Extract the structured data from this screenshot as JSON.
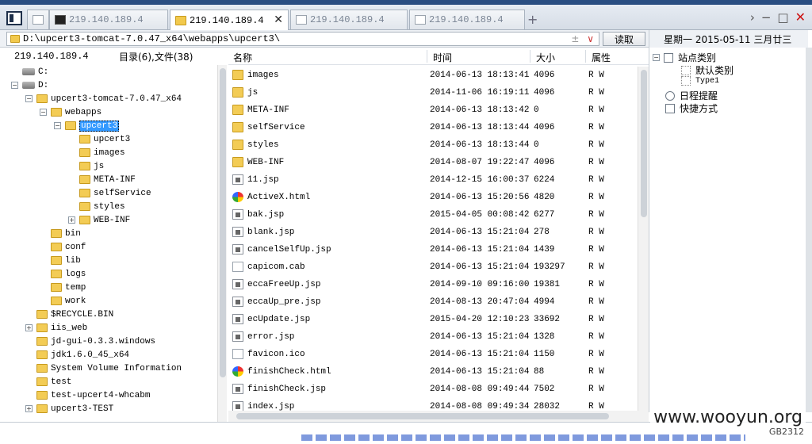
{
  "tabs": [
    {
      "label": "",
      "icon": "blank-page-icon",
      "active": false
    },
    {
      "label": "219.140.189.4",
      "icon": "terminal-icon",
      "active": false
    },
    {
      "label": "219.140.189.4",
      "icon": "folder-icon",
      "active": true
    },
    {
      "label": "219.140.189.4",
      "icon": "page-icon",
      "active": false
    },
    {
      "label": "219.140.189.4",
      "icon": "page-icon",
      "active": false
    }
  ],
  "address": {
    "path": "D:\\upcert3-tomcat-7.0.47_x64\\webapps\\upcert3\\",
    "read_label": "读取",
    "tools": "±"
  },
  "left_info": {
    "ip": "219.140.189.4",
    "counts": "目录(6),文件(38)"
  },
  "tree": [
    {
      "label": "C:",
      "type": "drive",
      "level": 0,
      "exp": ""
    },
    {
      "label": "D:",
      "type": "drive",
      "level": 0,
      "exp": "−"
    },
    {
      "label": "upcert3-tomcat-7.0.47_x64",
      "type": "folder",
      "level": 1,
      "exp": "−"
    },
    {
      "label": "webapps",
      "type": "folder",
      "level": 2,
      "exp": "−"
    },
    {
      "label": "upcert3",
      "type": "folder",
      "level": 3,
      "exp": "−",
      "selected": true
    },
    {
      "label": "upcert3",
      "type": "folder",
      "level": 4,
      "exp": ""
    },
    {
      "label": "images",
      "type": "folder",
      "level": 4,
      "exp": ""
    },
    {
      "label": "js",
      "type": "folder",
      "level": 4,
      "exp": ""
    },
    {
      "label": "META-INF",
      "type": "folder",
      "level": 4,
      "exp": ""
    },
    {
      "label": "selfService",
      "type": "folder",
      "level": 4,
      "exp": ""
    },
    {
      "label": "styles",
      "type": "folder",
      "level": 4,
      "exp": ""
    },
    {
      "label": "WEB-INF",
      "type": "folder",
      "level": 4,
      "exp": "+"
    },
    {
      "label": "bin",
      "type": "folder",
      "level": 2,
      "exp": ""
    },
    {
      "label": "conf",
      "type": "folder",
      "level": 2,
      "exp": ""
    },
    {
      "label": "lib",
      "type": "folder",
      "level": 2,
      "exp": ""
    },
    {
      "label": "logs",
      "type": "folder",
      "level": 2,
      "exp": ""
    },
    {
      "label": "temp",
      "type": "folder",
      "level": 2,
      "exp": ""
    },
    {
      "label": "work",
      "type": "folder",
      "level": 2,
      "exp": ""
    },
    {
      "label": "$RECYCLE.BIN",
      "type": "folder",
      "level": 1,
      "exp": ""
    },
    {
      "label": "iis_web",
      "type": "folder",
      "level": 1,
      "exp": "+"
    },
    {
      "label": "jd-gui-0.3.3.windows",
      "type": "folder",
      "level": 1,
      "exp": ""
    },
    {
      "label": "jdk1.6.0_45_x64",
      "type": "folder",
      "level": 1,
      "exp": ""
    },
    {
      "label": "System Volume Information",
      "type": "folder",
      "level": 1,
      "exp": ""
    },
    {
      "label": "test",
      "type": "folder",
      "level": 1,
      "exp": ""
    },
    {
      "label": "test-upcert4-whcabm",
      "type": "folder",
      "level": 1,
      "exp": ""
    },
    {
      "label": "upcert3-TEST",
      "type": "folder",
      "level": 1,
      "exp": "+"
    }
  ],
  "columns": {
    "name": "名称",
    "time": "时间",
    "size": "大小",
    "attr": "属性"
  },
  "files": [
    {
      "name": "images",
      "time": "2014-06-13 18:13:41",
      "size": "4096",
      "attr": "R W",
      "icon": "folder-icon"
    },
    {
      "name": "js",
      "time": "2014-11-06 16:19:11",
      "size": "4096",
      "attr": "R W",
      "icon": "folder-icon"
    },
    {
      "name": "META-INF",
      "time": "2014-06-13 18:13:42",
      "size": "0",
      "attr": "R W",
      "icon": "folder-icon"
    },
    {
      "name": "selfService",
      "time": "2014-06-13 18:13:44",
      "size": "4096",
      "attr": "R W",
      "icon": "folder-icon"
    },
    {
      "name": "styles",
      "time": "2014-06-13 18:13:44",
      "size": "0",
      "attr": "R W",
      "icon": "folder-icon"
    },
    {
      "name": "WEB-INF",
      "time": "2014-08-07 19:22:47",
      "size": "4096",
      "attr": "R W",
      "icon": "folder-icon"
    },
    {
      "name": "11.jsp",
      "time": "2014-12-15 16:00:37",
      "size": "6224",
      "attr": "R W",
      "icon": "jsp-icon"
    },
    {
      "name": "ActiveX.html",
      "time": "2014-06-13 15:20:56",
      "size": "4820",
      "attr": "R W",
      "icon": "html-icon"
    },
    {
      "name": "bak.jsp",
      "time": "2015-04-05 00:08:42",
      "size": "6277",
      "attr": "R W",
      "icon": "jsp-icon"
    },
    {
      "name": "blank.jsp",
      "time": "2014-06-13 15:21:04",
      "size": "278",
      "attr": "R W",
      "icon": "jsp-icon"
    },
    {
      "name": "cancelSelfUp.jsp",
      "time": "2014-06-13 15:21:04",
      "size": "1439",
      "attr": "R W",
      "icon": "jsp-icon"
    },
    {
      "name": "capicom.cab",
      "time": "2014-06-13 15:21:04",
      "size": "193297",
      "attr": "R W",
      "icon": "blank-file-icon"
    },
    {
      "name": "eccaFreeUp.jsp",
      "time": "2014-09-10 09:16:00",
      "size": "19381",
      "attr": "R W",
      "icon": "jsp-icon"
    },
    {
      "name": "eccaUp_pre.jsp",
      "time": "2014-08-13 20:47:04",
      "size": "4994",
      "attr": "R W",
      "icon": "jsp-icon"
    },
    {
      "name": "ecUpdate.jsp",
      "time": "2015-04-20 12:10:23",
      "size": "33692",
      "attr": "R W",
      "icon": "jsp-icon"
    },
    {
      "name": "error.jsp",
      "time": "2014-06-13 15:21:04",
      "size": "1328",
      "attr": "R W",
      "icon": "jsp-icon"
    },
    {
      "name": "favicon.ico",
      "time": "2014-06-13 15:21:04",
      "size": "1150",
      "attr": "R W",
      "icon": "blank-file-icon"
    },
    {
      "name": "finishCheck.html",
      "time": "2014-06-13 15:21:04",
      "size": "88",
      "attr": "R W",
      "icon": "html-icon"
    },
    {
      "name": "finishCheck.jsp",
      "time": "2014-08-08 09:49:44",
      "size": "7502",
      "attr": "R W",
      "icon": "jsp-icon"
    },
    {
      "name": "index.jsp",
      "time": "2014-08-08 09:49:34",
      "size": "28032",
      "attr": "R W",
      "icon": "jsp-icon"
    }
  ],
  "right_panel": {
    "date": "星期一  2015-05-11  三月廿三",
    "site_category": "站点类别",
    "default_category": "默认类别",
    "type1": "Type1",
    "schedule": "日程提醒",
    "shortcuts": "快捷方式"
  },
  "watermark": "www.wooyun.org",
  "encoding": "GB2312"
}
